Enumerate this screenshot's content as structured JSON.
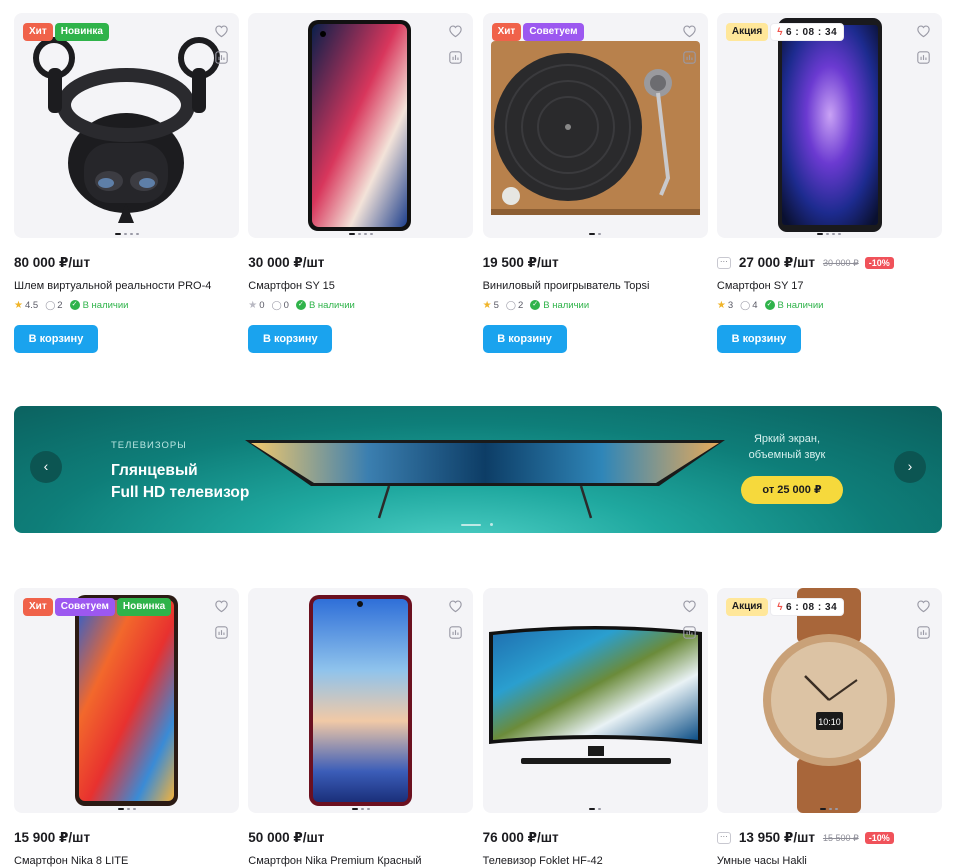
{
  "products_top": [
    {
      "badges": [
        {
          "type": "hit",
          "label": "Хит"
        },
        {
          "type": "new",
          "label": "Новинка"
        }
      ],
      "price": "80 000 ₽/шт",
      "title": "Шлем виртуальной реальности PRO-4",
      "rating": "4.5",
      "comments": "2",
      "stock": "В наличии",
      "button": "В корзину",
      "image": "vr-headset"
    },
    {
      "badges": [],
      "price": "30 000 ₽/шт",
      "title": "Смартфон SY 15",
      "rating": "0",
      "comments": "0",
      "stock": "В наличии",
      "button": "В корзину",
      "image": "smartphone-sy15"
    },
    {
      "badges": [
        {
          "type": "hit",
          "label": "Хит"
        },
        {
          "type": "rec",
          "label": "Советуем"
        }
      ],
      "price": "19 500 ₽/шт",
      "title": "Виниловый проигрыватель Topsi",
      "rating": "5",
      "comments": "2",
      "stock": "В наличии",
      "button": "В корзину",
      "image": "turntable"
    },
    {
      "badges": [
        {
          "type": "promo",
          "label": "Акция"
        },
        {
          "type": "timer",
          "label": "6 : 08 : 34"
        }
      ],
      "price": "27 000 ₽/шт",
      "old_price": "30 000 ₽",
      "discount": "-10%",
      "title": "Смартфон SY 17",
      "rating": "3",
      "comments": "4",
      "stock": "В наличии",
      "button": "В корзину",
      "image": "smartphone-sy17"
    }
  ],
  "banner": {
    "category": "ТЕЛЕВИЗОРЫ",
    "headline_1": "Глянцевый",
    "headline_2": "Full HD телевизор",
    "subtitle_1": "Яркий экран,",
    "subtitle_2": "объемный звук",
    "price_button": "от 25 000 ₽",
    "prev": "‹",
    "next": "›",
    "active_slide": 1,
    "slides": 2
  },
  "products_bottom": [
    {
      "badges": [
        {
          "type": "hit",
          "label": "Хит"
        },
        {
          "type": "rec",
          "label": "Советуем"
        },
        {
          "type": "new",
          "label": "Новинка"
        }
      ],
      "price": "15 900 ₽/шт",
      "title": "Смартфон Nika 8 LITE",
      "image": "smartphone-nika8"
    },
    {
      "badges": [],
      "price": "50 000 ₽/шт",
      "title": "Смартфон Nika Premium Красный",
      "image": "smartphone-nika-premium"
    },
    {
      "badges": [],
      "price": "76 000 ₽/шт",
      "title": "Телевизор Foklet HF-42",
      "image": "tv-foklet"
    },
    {
      "badges": [
        {
          "type": "promo",
          "label": "Акция"
        },
        {
          "type": "timer",
          "label": "6 : 08 : 34"
        }
      ],
      "price": "13 950 ₽/шт",
      "old_price": "15 500 ₽",
      "discount": "-10%",
      "title": "Умные часы Hakli",
      "image": "smartwatch",
      "watch_time": "10:10"
    }
  ],
  "colors": {
    "accent": "#1aa3ee",
    "hit": "#f0624a",
    "new": "#2fb34a",
    "recommend": "#9c58f0",
    "promo": "#ffe79a",
    "discount": "#f0525a",
    "banner": "#0e7e79",
    "banner_button": "#f6d93c"
  }
}
